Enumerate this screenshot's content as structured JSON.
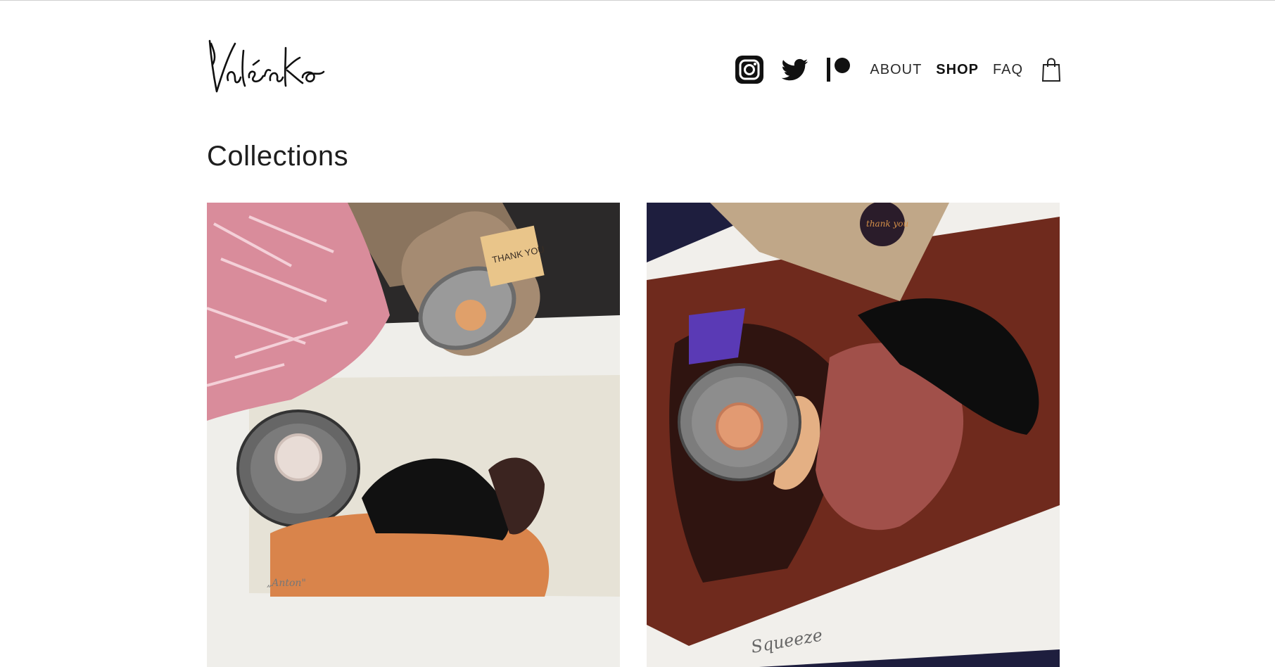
{
  "header": {
    "logo_text": "Valéra Ko",
    "nav": {
      "instagram_icon": "instagram-icon",
      "twitter_icon": "twitter-icon",
      "patreon_icon": "patreon-icon",
      "about_label": "ABOUT",
      "shop_label": "SHOP",
      "faq_label": "FAQ",
      "cart_icon": "shopping-bag-icon"
    }
  },
  "main": {
    "title": "Collections",
    "collections": [
      {
        "image": "print-with-cat-and-woman-photo",
        "sticker_text": "THANK YOU",
        "print_caption": "„Anton\""
      },
      {
        "image": "print-squeeze-embrace-photo",
        "sticker_text": "thank you",
        "print_caption": "Squeeze"
      }
    ]
  },
  "colors": {
    "text": "#1f1f1f",
    "background": "#ffffff"
  }
}
